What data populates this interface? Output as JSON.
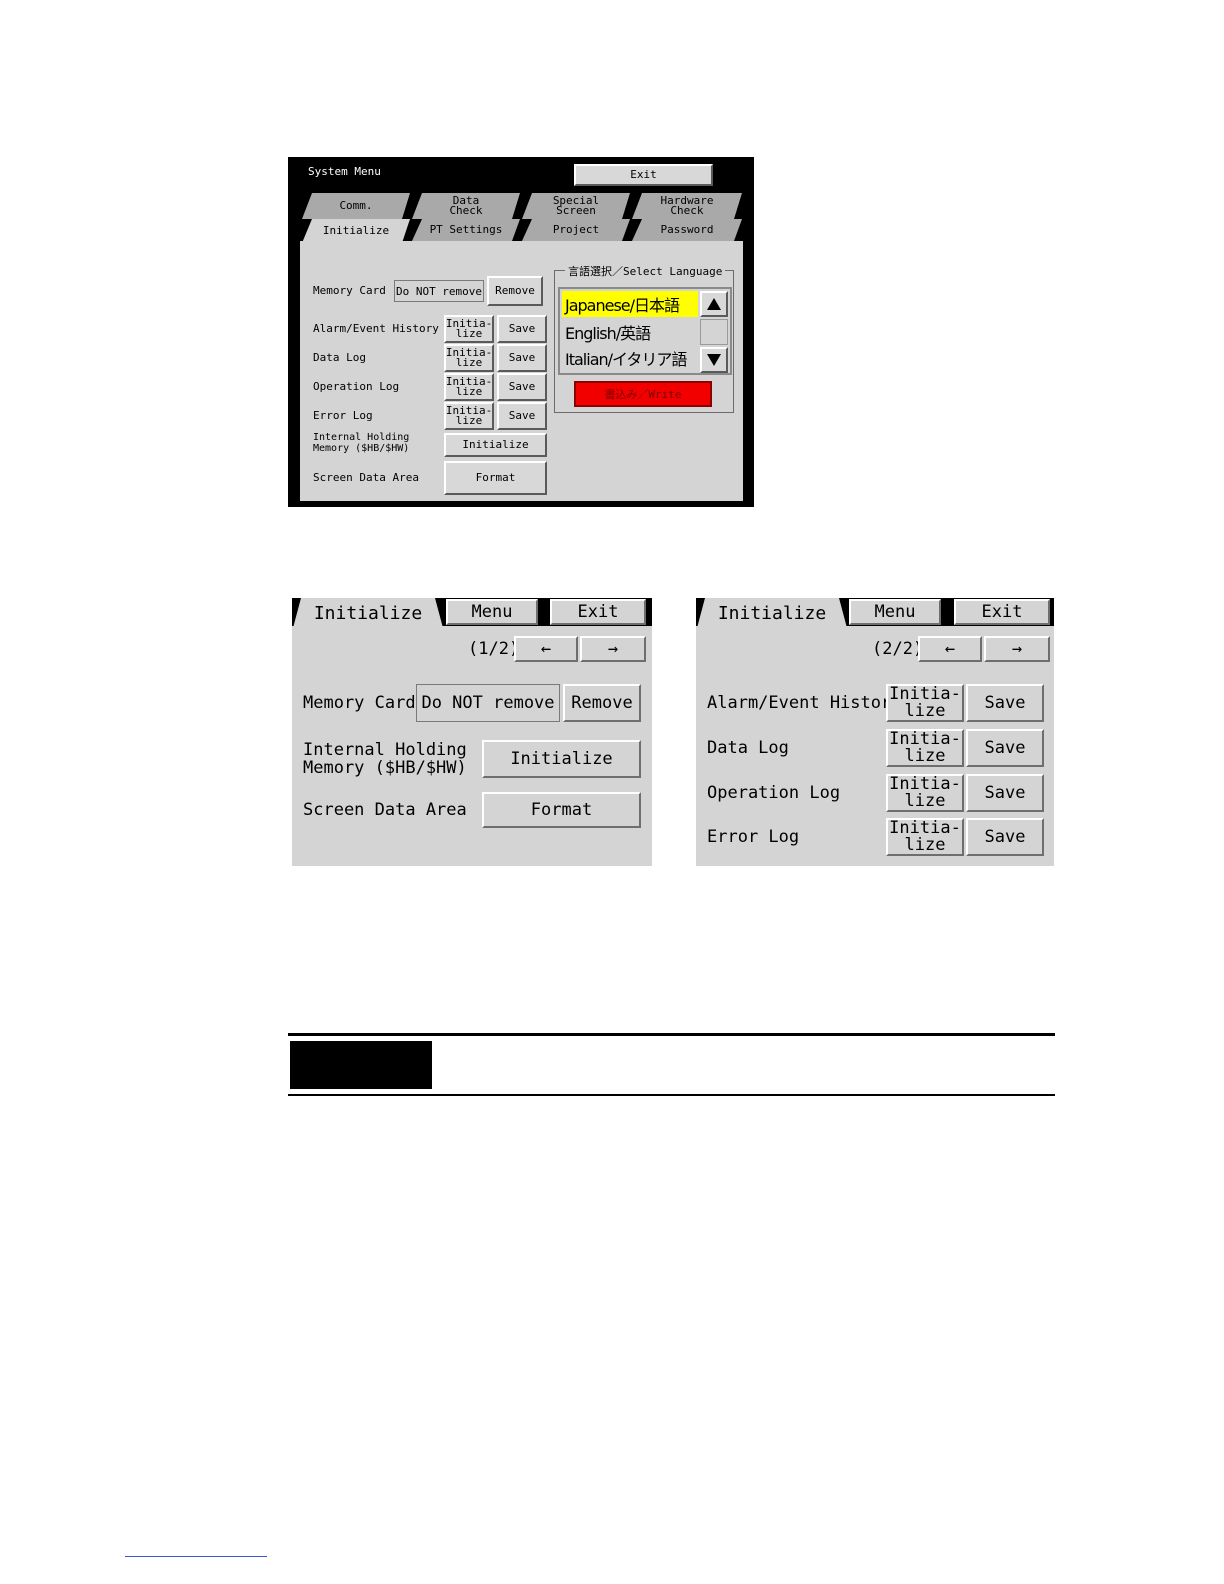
{
  "system_menu": {
    "title": "System Menu",
    "exit_label": "Exit",
    "tabs_top": [
      "Comm.",
      "Data\nCheck",
      "Special\nScreen",
      "Hardware\nCheck"
    ],
    "tabs_bottom": [
      "Initialize",
      "PT Settings",
      "Project",
      "Password"
    ],
    "memory_card_label": "Memory Card",
    "memory_card_value": "Do NOT remove",
    "remove_label": "Remove",
    "rows": [
      {
        "label": "Alarm/Event History",
        "init": "Initia-\nlize",
        "save": "Save"
      },
      {
        "label": "Data Log",
        "init": "Initia-\nlize",
        "save": "Save"
      },
      {
        "label": "Operation Log",
        "init": "Initia-\nlize",
        "save": "Save"
      },
      {
        "label": "Error Log",
        "init": "Initia-\nlize",
        "save": "Save"
      }
    ],
    "internal_holding_label": "Internal Holding\nMemory ($HB/$HW)",
    "initialize_label": "Initialize",
    "screen_data_label": "Screen Data Area",
    "format_label": "Format",
    "language": {
      "legend": "言語選択／Select Language",
      "items": [
        "Japanese/日本語",
        "English/英語",
        "Italian/イタリア語"
      ],
      "selected_color": "#ffff00",
      "write_label": "書込み／Write"
    }
  },
  "page1": {
    "tab": "Initialize",
    "menu": "Menu",
    "exit": "Exit",
    "page_indicator": "(1/2)",
    "prev": "←",
    "next": "→",
    "memory_card_label": "Memory Card",
    "memory_card_value": "Do NOT remove",
    "remove_label": "Remove",
    "internal_holding_label": "Internal Holding\nMemory ($HB/$HW)",
    "initialize_label": "Initialize",
    "screen_data_label": "Screen Data Area",
    "format_label": "Format"
  },
  "page2": {
    "tab": "Initialize",
    "menu": "Menu",
    "exit": "Exit",
    "page_indicator": "(2/2)",
    "prev": "←",
    "next": "→",
    "rows": [
      {
        "label": "Alarm/Event History",
        "init": "Initia-\nlize",
        "save": "Save"
      },
      {
        "label": "Data Log",
        "init": "Initia-\nlize",
        "save": "Save"
      },
      {
        "label": "Operation Log",
        "init": "Initia-\nlize",
        "save": "Save"
      },
      {
        "label": "Error Log",
        "init": "Initia-\nlize",
        "save": "Save"
      }
    ]
  }
}
